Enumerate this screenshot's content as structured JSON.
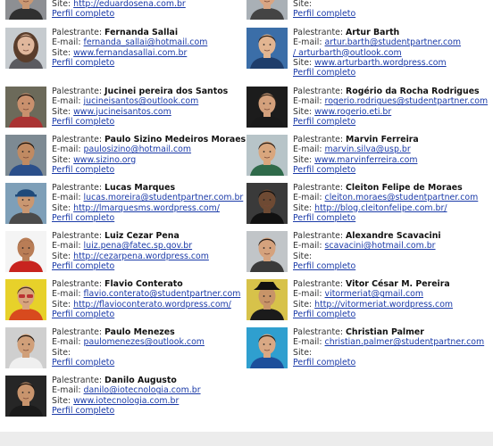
{
  "labels": {
    "speaker": "Palestrante: ",
    "email": "E-mail: ",
    "site": "Site: ",
    "profile": "Perfil completo"
  },
  "colors": {
    "link": "#1a3aa8",
    "footer": "#ececec"
  },
  "speakers": [
    {
      "name": "",
      "email": "",
      "site": "http://eduardosena.com.br",
      "photo": "man-short-hair",
      "skin": "#c99873",
      "hair": "#2a1e17",
      "bg": "#8d8f93",
      "shirt": "#303030"
    },
    {
      "name": "",
      "email": "",
      "site": "",
      "photo": "man-short-hair",
      "skin": "#d8a583",
      "hair": "#3a2a20",
      "bg": "#a9b0b6",
      "shirt": "#444"
    },
    {
      "name": "Fernanda Sallai",
      "email": "fernanda_sallai@hotmail.com",
      "site": "www.fernandasallai.com.br",
      "photo": "woman-long-hair",
      "skin": "#e0b79c",
      "hair": "#5a3d2b",
      "bg": "#c6cbcf",
      "shirt": "#5b5b60"
    },
    {
      "name": "Artur Barth",
      "email": "artur.barth@studentpartner.com / arturbarth@outlook.com",
      "site": "www.arturbarth.wordpress.com",
      "photo": "man-short-hair",
      "skin": "#e2b591",
      "hair": "#2e2118",
      "bg": "#3b6ea8",
      "shirt": "#1e3d6b"
    },
    {
      "name": "Jucinei pereira dos Santos",
      "email": "jucineisantos@outlook.com",
      "site": "www.jucineisantos.com",
      "photo": "man-short-hair",
      "skin": "#c9906d",
      "hair": "#1e1612",
      "bg": "#6c6a5a",
      "shirt": "#a33"
    },
    {
      "name": "Rogério da Rocha Rodrigues",
      "email": "rogerio.rodrigues@studentpartner.com",
      "site": "www.rogerio.eti.br",
      "photo": "man-short-hair",
      "skin": "#d3a07c",
      "hair": "#3a2c1f",
      "bg": "#1c1c1c",
      "shirt": "#1a1a1a"
    },
    {
      "name": "Paulo Sizino Medeiros Moraes",
      "email": "paulosizino@hotmail.com",
      "site": "www.sizino.org",
      "photo": "man-short-hair",
      "skin": "#c08a62",
      "hair": "#1a130e",
      "bg": "#7d8a93",
      "shirt": "#2b4f8a"
    },
    {
      "name": "Marvin Ferreira",
      "email": "marvin.silva@usp.br",
      "site": "www.marvinferreira.com",
      "photo": "man-short-hair",
      "skin": "#d9a67d",
      "hair": "#2a1f18",
      "bg": "#b7c4c8",
      "shirt": "#2f6a4a"
    },
    {
      "name": "Lucas Marques",
      "email": "lucas.moreira@studentpartner.com.br",
      "site": "http://lmarquesms.wordpress.com/",
      "photo": "man-cap",
      "skin": "#c99771",
      "hair": "#2a1f18",
      "bg": "#7e9fb8",
      "shirt": "#4b4b4b"
    },
    {
      "name": "Cleiton Felipe de Moraes",
      "email": "cleiton.moraes@studentpartner.com",
      "site": "http://blog.cleitonfelipe.com.br/",
      "photo": "man-short-hair",
      "skin": "#6e4a33",
      "hair": "#111",
      "bg": "#3a3a3a",
      "shirt": "#111"
    },
    {
      "name": "Luiz Cezar Pena",
      "email": "luiz.pena@fatec.sp.gov.br",
      "site": "http://cezarpena.wordpress.com",
      "photo": "man-bald",
      "skin": "#b97d56",
      "hair": "#3b2a1d",
      "bg": "#f4f4f4",
      "shirt": "#c8241f"
    },
    {
      "name": "Alexandre Scavacini",
      "email": "scavacini@hotmail.com.br",
      "site": "",
      "photo": "man-short-hair",
      "skin": "#d5a27d",
      "hair": "#2a1f18",
      "bg": "#c1c5c8",
      "shirt": "#3a3a3a"
    },
    {
      "name": "Flavio Conterato",
      "email": "flavio.conterato@studentpartner.com",
      "site": "http://flavioconterato.wordpress.com/",
      "photo": "man-glasses",
      "skin": "#d8a47e",
      "hair": "#4a3323",
      "bg": "#e7d12a",
      "shirt": "#d84a1e"
    },
    {
      "name": "Vitor César M. Pereira",
      "email": "vitormeriat@gmail.com",
      "site": "http://vitormeriat.wordpress.com",
      "photo": "man-hat",
      "skin": "#c89468",
      "hair": "#111",
      "bg": "#d7c24a",
      "shirt": "#1b1b1b"
    },
    {
      "name": "Paulo Menezes",
      "email": "paulomenezes@outlook.com",
      "site": "",
      "photo": "man-short-hair",
      "skin": "#d09f79",
      "hair": "#231a14",
      "bg": "#cfcfcf",
      "shirt": "#efefef"
    },
    {
      "name": "Christian Palmer",
      "email": "christian.palmer@studentpartner.com",
      "site": "",
      "photo": "man-short-hair",
      "skin": "#d9a884",
      "hair": "#2a2018",
      "bg": "#2f9fcf",
      "shirt": "#1d4f9b"
    },
    {
      "name": "Danilo Augusto",
      "email": "danilo@iotecnologia.com.br",
      "site": "www.iotecnologia.com.br",
      "photo": "man-short-hair",
      "skin": "#c8946d",
      "hair": "#1a130f",
      "bg": "#262626",
      "shirt": "#1a1a1a"
    }
  ]
}
